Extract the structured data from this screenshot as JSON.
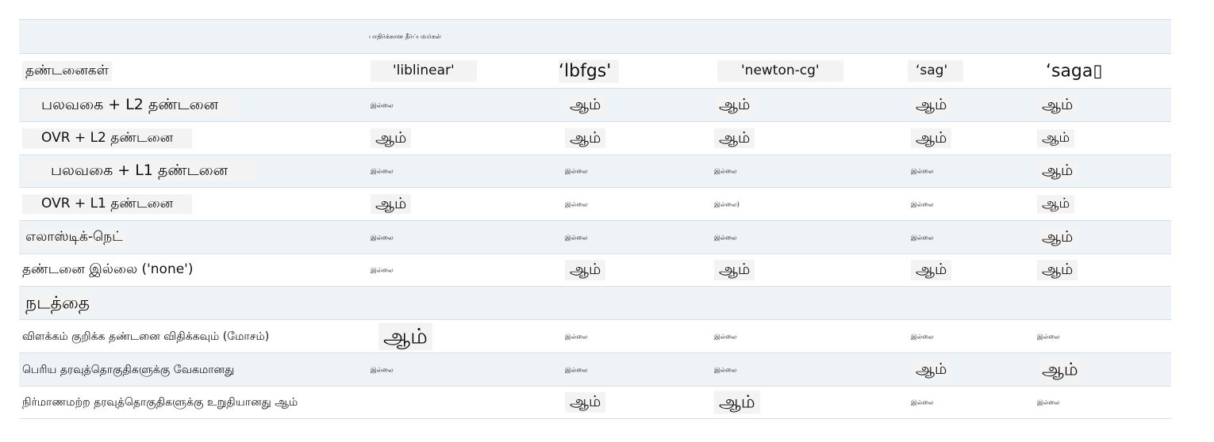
{
  "table": {
    "top_header": "பாதிர்க்கான தீர்ப்பவர்கள்",
    "header_label": "தண்டனைகள்",
    "solvers": [
      "'liblinear'",
      "‘lbfgs'",
      "'newton-cg'",
      "‘sag'",
      "‘saga▯"
    ],
    "rows": [
      {
        "label": "பலவகை + L2 தண்டனை",
        "values": [
          "இல்லை",
          "ஆம்",
          "ஆம்",
          "ஆம்",
          "ஆம்"
        ]
      },
      {
        "label": "OVR + L2 தண்டனை",
        "values": [
          "ஆம்",
          "ஆம்",
          "ஆம்",
          "ஆம்",
          "ஆம்"
        ]
      },
      {
        "label": "பலவகை + L1 தண்டனை",
        "values": [
          "இல்லை",
          "இல்லை",
          "இல்லை",
          "இல்லை",
          "ஆம்"
        ]
      },
      {
        "label": "OVR + L1 தண்டனை",
        "values": [
          "ஆம்",
          "இல்லை",
          "இல்லை)",
          "இல்லை",
          "ஆம்"
        ]
      },
      {
        "label": "எலாஸ்டிக்-நெட்",
        "values": [
          "இல்லை",
          "இல்லை",
          "இல்லை",
          "இல்லை",
          "ஆம்"
        ]
      },
      {
        "label": "தண்டனை இல்லை ('none')",
        "values": [
          "இல்லை",
          "ஆம்",
          "ஆம்",
          "ஆம்",
          "ஆம்"
        ]
      },
      {
        "label": "நடத்தை",
        "values": [
          "",
          "",
          "",
          "",
          ""
        ]
      },
      {
        "label": "விளக்கம் குறிக்க தண்டனை விதிக்கவும் (மோசம்)",
        "values": [
          "ஆம்",
          "இல்லை",
          "இல்லை",
          "இல்லை",
          "இல்லை"
        ]
      },
      {
        "label": "பெரிய தரவுத்தொகுதிகளுக்கு வேகமானது",
        "values": [
          "இல்லை",
          "இல்லை",
          "இல்லை",
          "ஆம்",
          "ஆம்"
        ]
      },
      {
        "label": "நிர்மாணமற்ற தரவுத்தொகுதிகளுக்கு உறுதியானது ஆம்",
        "values": [
          "",
          "ஆம்",
          "ஆம்",
          "இல்லை",
          "இல்லை"
        ]
      }
    ]
  }
}
